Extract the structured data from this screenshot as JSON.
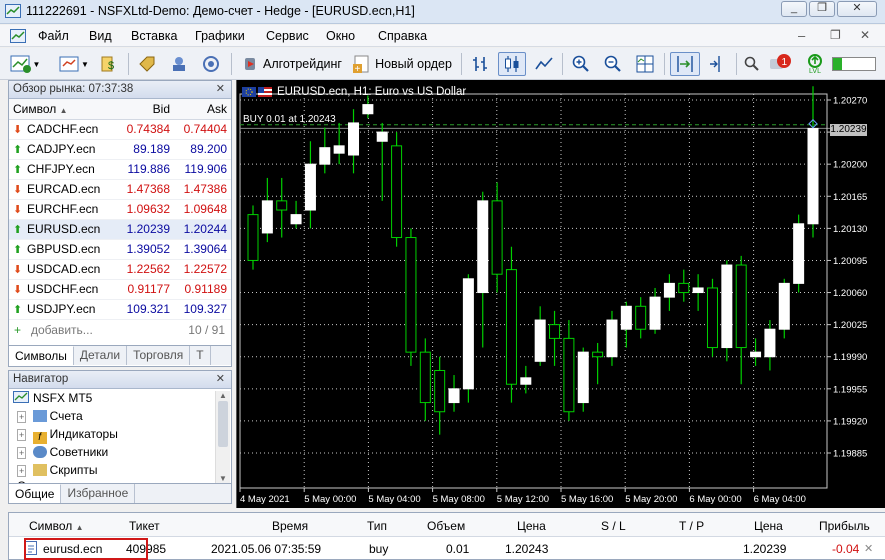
{
  "window": {
    "title": "111222691 - NSFXLtd-Demo: Демо-счет - Hedge - [EURUSD.ecn,H1]",
    "min": "_",
    "restore": "❐",
    "close": "✕"
  },
  "menu": [
    "Файл",
    "Вид",
    "Вставка",
    "Графики",
    "Сервис",
    "Окно",
    "Справка"
  ],
  "toolbar": {
    "algo": "Алготрейдинг",
    "new_order": "Новый ордер",
    "badge": "1",
    "lvl": "LVL"
  },
  "market_watch": {
    "title": "Обзор рынка: 07:37:38",
    "col_symbol": "Символ",
    "col_bid": "Bid",
    "col_ask": "Ask",
    "rows": [
      {
        "symbol": "CADCHF.ecn",
        "bid": "0.74384",
        "ask": "0.74404",
        "dir": "down"
      },
      {
        "symbol": "CADJPY.ecn",
        "bid": "89.189",
        "ask": "89.200",
        "dir": "up"
      },
      {
        "symbol": "CHFJPY.ecn",
        "bid": "119.886",
        "ask": "119.906",
        "dir": "up"
      },
      {
        "symbol": "EURCAD.ecn",
        "bid": "1.47368",
        "ask": "1.47386",
        "dir": "down"
      },
      {
        "symbol": "EURCHF.ecn",
        "bid": "1.09632",
        "ask": "1.09648",
        "dir": "down"
      },
      {
        "symbol": "EURUSD.ecn",
        "bid": "1.20239",
        "ask": "1.20244",
        "dir": "up"
      },
      {
        "symbol": "GBPUSD.ecn",
        "bid": "1.39052",
        "ask": "1.39064",
        "dir": "up"
      },
      {
        "symbol": "USDCAD.ecn",
        "bid": "1.22562",
        "ask": "1.22572",
        "dir": "down"
      },
      {
        "symbol": "USDCHF.ecn",
        "bid": "0.91177",
        "ask": "0.91189",
        "dir": "down"
      },
      {
        "symbol": "USDJPY.ecn",
        "bid": "109.321",
        "ask": "109.327",
        "dir": "up"
      }
    ],
    "add": "добавить...",
    "count": "10 / 91",
    "tabs": [
      "Символы",
      "Детали",
      "Торговля",
      "Т"
    ]
  },
  "navigator": {
    "title": "Навигатор",
    "root": "NSFX MT5",
    "items": [
      "Счета",
      "Индикаторы",
      "Советники",
      "Скрипты",
      "С"
    ],
    "tabs": [
      "Общие",
      "Избранное"
    ]
  },
  "chart_data": {
    "type": "candlestick",
    "title": "EURUSD.ecn, H1:  Euro vs US Dollar",
    "trade_label": "BUY 0.01 at 1.20243",
    "current_price": "1.20239",
    "ylim": [
      1.1985,
      1.2031
    ],
    "yticks": [
      "1.20270",
      "1.20235",
      "1.20200",
      "1.20165",
      "1.20130",
      "1.20095",
      "1.20060",
      "1.20025",
      "1.19990",
      "1.19955",
      "1.19920",
      "1.19885"
    ],
    "xticks": [
      "4 May 2021",
      "5 May 00:00",
      "5 May 04:00",
      "5 May 08:00",
      "5 May 12:00",
      "5 May 16:00",
      "5 May 20:00",
      "6 May 00:00",
      "6 May 04:00"
    ],
    "candles": [
      {
        "o": 1.20145,
        "h": 1.20155,
        "l": 1.20085,
        "c": 1.20095
      },
      {
        "o": 1.20125,
        "h": 1.20185,
        "l": 1.20115,
        "c": 1.2016
      },
      {
        "o": 1.2016,
        "h": 1.20185,
        "l": 1.2012,
        "c": 1.2015
      },
      {
        "o": 1.20135,
        "h": 1.2016,
        "l": 1.2013,
        "c": 1.20145
      },
      {
        "o": 1.2015,
        "h": 1.20225,
        "l": 1.2013,
        "c": 1.202
      },
      {
        "o": 1.202,
        "h": 1.2024,
        "l": 1.2019,
        "c": 1.20218
      },
      {
        "o": 1.20212,
        "h": 1.20245,
        "l": 1.202,
        "c": 1.2022
      },
      {
        "o": 1.2021,
        "h": 1.2026,
        "l": 1.2019,
        "c": 1.20245
      },
      {
        "o": 1.20255,
        "h": 1.20275,
        "l": 1.2025,
        "c": 1.20265
      },
      {
        "o": 1.20225,
        "h": 1.20245,
        "l": 1.2016,
        "c": 1.20235
      },
      {
        "o": 1.2022,
        "h": 1.20235,
        "l": 1.2011,
        "c": 1.2012
      },
      {
        "o": 1.2012,
        "h": 1.2013,
        "l": 1.1998,
        "c": 1.19995
      },
      {
        "o": 1.19995,
        "h": 1.2001,
        "l": 1.1992,
        "c": 1.1994
      },
      {
        "o": 1.19975,
        "h": 1.1999,
        "l": 1.19905,
        "c": 1.1993
      },
      {
        "o": 1.1994,
        "h": 1.1997,
        "l": 1.1993,
        "c": 1.19955
      },
      {
        "o": 1.19955,
        "h": 1.2008,
        "l": 1.1994,
        "c": 1.20075
      },
      {
        "o": 1.2006,
        "h": 1.2017,
        "l": 1.2,
        "c": 1.2016
      },
      {
        "o": 1.2016,
        "h": 1.2018,
        "l": 1.2006,
        "c": 1.2008
      },
      {
        "o": 1.20085,
        "h": 1.2011,
        "l": 1.1994,
        "c": 1.1996
      },
      {
        "o": 1.1996,
        "h": 1.1998,
        "l": 1.1995,
        "c": 1.19967
      },
      {
        "o": 1.19985,
        "h": 1.20045,
        "l": 1.1998,
        "c": 1.2003
      },
      {
        "o": 1.20025,
        "h": 1.2004,
        "l": 1.1998,
        "c": 1.2001
      },
      {
        "o": 1.2001,
        "h": 1.2003,
        "l": 1.1992,
        "c": 1.1993
      },
      {
        "o": 1.1994,
        "h": 1.2,
        "l": 1.1993,
        "c": 1.19995
      },
      {
        "o": 1.19995,
        "h": 1.20005,
        "l": 1.1996,
        "c": 1.1999
      },
      {
        "o": 1.1999,
        "h": 1.2004,
        "l": 1.1998,
        "c": 1.2003
      },
      {
        "o": 1.2002,
        "h": 1.2005,
        "l": 1.2,
        "c": 1.20045
      },
      {
        "o": 1.20045,
        "h": 1.20055,
        "l": 1.2001,
        "c": 1.2002
      },
      {
        "o": 1.2002,
        "h": 1.20065,
        "l": 1.20015,
        "c": 1.20055
      },
      {
        "o": 1.20055,
        "h": 1.2008,
        "l": 1.2004,
        "c": 1.2007
      },
      {
        "o": 1.2007,
        "h": 1.20085,
        "l": 1.2005,
        "c": 1.2006
      },
      {
        "o": 1.2006,
        "h": 1.2008,
        "l": 1.2004,
        "c": 1.20065
      },
      {
        "o": 1.20065,
        "h": 1.20075,
        "l": 1.1999,
        "c": 1.2
      },
      {
        "o": 1.2,
        "h": 1.20095,
        "l": 1.19985,
        "c": 1.2009
      },
      {
        "o": 1.2009,
        "h": 1.201,
        "l": 1.1996,
        "c": 1.2
      },
      {
        "o": 1.1999,
        "h": 1.2001,
        "l": 1.1998,
        "c": 1.19995
      },
      {
        "o": 1.1999,
        "h": 1.2003,
        "l": 1.19975,
        "c": 1.2002
      },
      {
        "o": 1.2002,
        "h": 1.20075,
        "l": 1.2001,
        "c": 1.2007
      },
      {
        "o": 1.2007,
        "h": 1.20145,
        "l": 1.2006,
        "c": 1.20135
      },
      {
        "o": 1.20135,
        "h": 1.20285,
        "l": 1.2012,
        "c": 1.20239
      }
    ]
  },
  "positions": {
    "cols": [
      "Символ",
      "Тикет",
      "Время",
      "Тип",
      "Объем",
      "Цена",
      "S / L",
      "T / P",
      "Цена",
      "Прибыль"
    ],
    "row": {
      "symbol": "eurusd.ecn",
      "ticket": "409985",
      "time": "2021.05.06 07:35:59",
      "type": "buy",
      "volume": "0.01",
      "price": "1.20243",
      "sl": "",
      "tp": "",
      "cur_price": "1.20239",
      "profit": "-0.04"
    }
  }
}
